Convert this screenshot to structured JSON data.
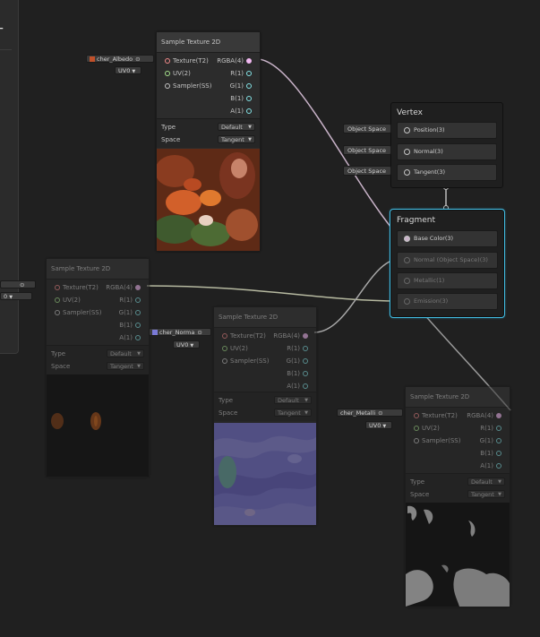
{
  "blackboard": {
    "add_label": "+"
  },
  "sample_label": "Sample Texture 2D",
  "ports": {
    "texture": "Texture(T2)",
    "uv": "UV(2)",
    "sampler": "Sampler(SS)",
    "rgba": "RGBA(4)",
    "r": "R(1)",
    "g": "G(1)",
    "b": "B(1)",
    "a": "A(1)"
  },
  "settings": {
    "type_label": "Type",
    "type_value": "Default",
    "space_label": "Space",
    "space_value": "Tangent"
  },
  "nodes": {
    "albedo": {
      "texture_field": "cher_Albedo",
      "uv_field": "UV0"
    },
    "left": {
      "texture_field": "",
      "uv_field": "0"
    },
    "normal": {
      "texture_field": "cher_Norma",
      "uv_field": "UV0"
    },
    "metallic": {
      "texture_field": "cher_Metalli",
      "uv_field": "UV0"
    }
  },
  "vertex": {
    "title": "Vertex",
    "blocks": [
      {
        "label": "Position(3)",
        "input": "Object Space"
      },
      {
        "label": "Normal(3)",
        "input": "Object Space"
      },
      {
        "label": "Tangent(3)",
        "input": "Object Space"
      }
    ]
  },
  "fragment": {
    "title": "Fragment",
    "blocks": [
      {
        "label": "Base Color(3)"
      },
      {
        "label": "Normal (Object Space)(3)"
      },
      {
        "label": "Metallic(1)"
      },
      {
        "label": "Emission(3)"
      }
    ]
  },
  "colors": {
    "texture_port": "#f28a8a",
    "uv_port": "#a5e08c",
    "vector4_port": "#f0b8f0",
    "vector1_port": "#84e4e7",
    "vector3_port": "#f6ff9a",
    "selection": "#44c0e6"
  },
  "icons": {
    "add": "plus-icon",
    "texture_swatch": "texture-swatch-icon",
    "dropdown": "caret-down-icon",
    "port": "port-circle-icon"
  }
}
